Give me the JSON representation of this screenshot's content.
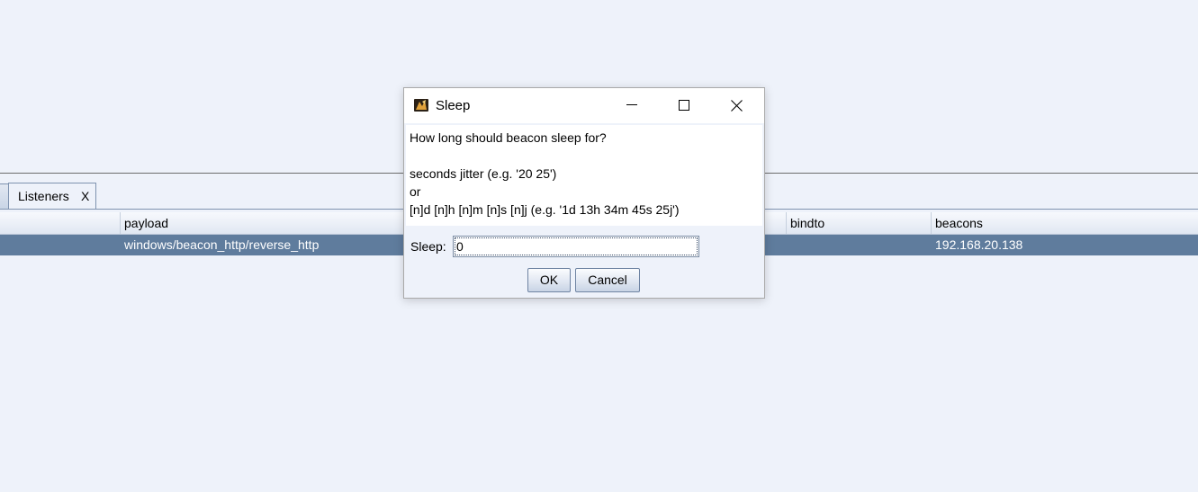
{
  "background": {
    "tabs": [
      {
        "label": "Listeners",
        "close_label": "X"
      }
    ],
    "table": {
      "columns": [
        "",
        "payload",
        "",
        "bindto",
        "beacons"
      ],
      "rows": [
        {
          "cells": [
            "",
            "windows/beacon_http/reverse_http",
            "",
            "",
            "192.168.20.138"
          ],
          "selected": true
        }
      ]
    }
  },
  "dialog": {
    "title": "Sleep",
    "icon": "cobalt-strike-app-icon",
    "window_controls": [
      "minimize-icon",
      "maximize-icon",
      "close-icon"
    ],
    "message_lines": [
      "How long should beacon sleep for?",
      "",
      "seconds jitter (e.g. '20 25')",
      "or",
      "[n]d [n]h [n]m [n]s [n]j (e.g. '1d 13h 34m 45s 25j')"
    ],
    "field_label": "Sleep:",
    "field_value": "0",
    "buttons": {
      "ok": "OK",
      "cancel": "Cancel"
    }
  },
  "colors": {
    "background": "#eef2fa",
    "selected_row": "#5f7c9d",
    "selected_row_text": "#ffffff"
  }
}
